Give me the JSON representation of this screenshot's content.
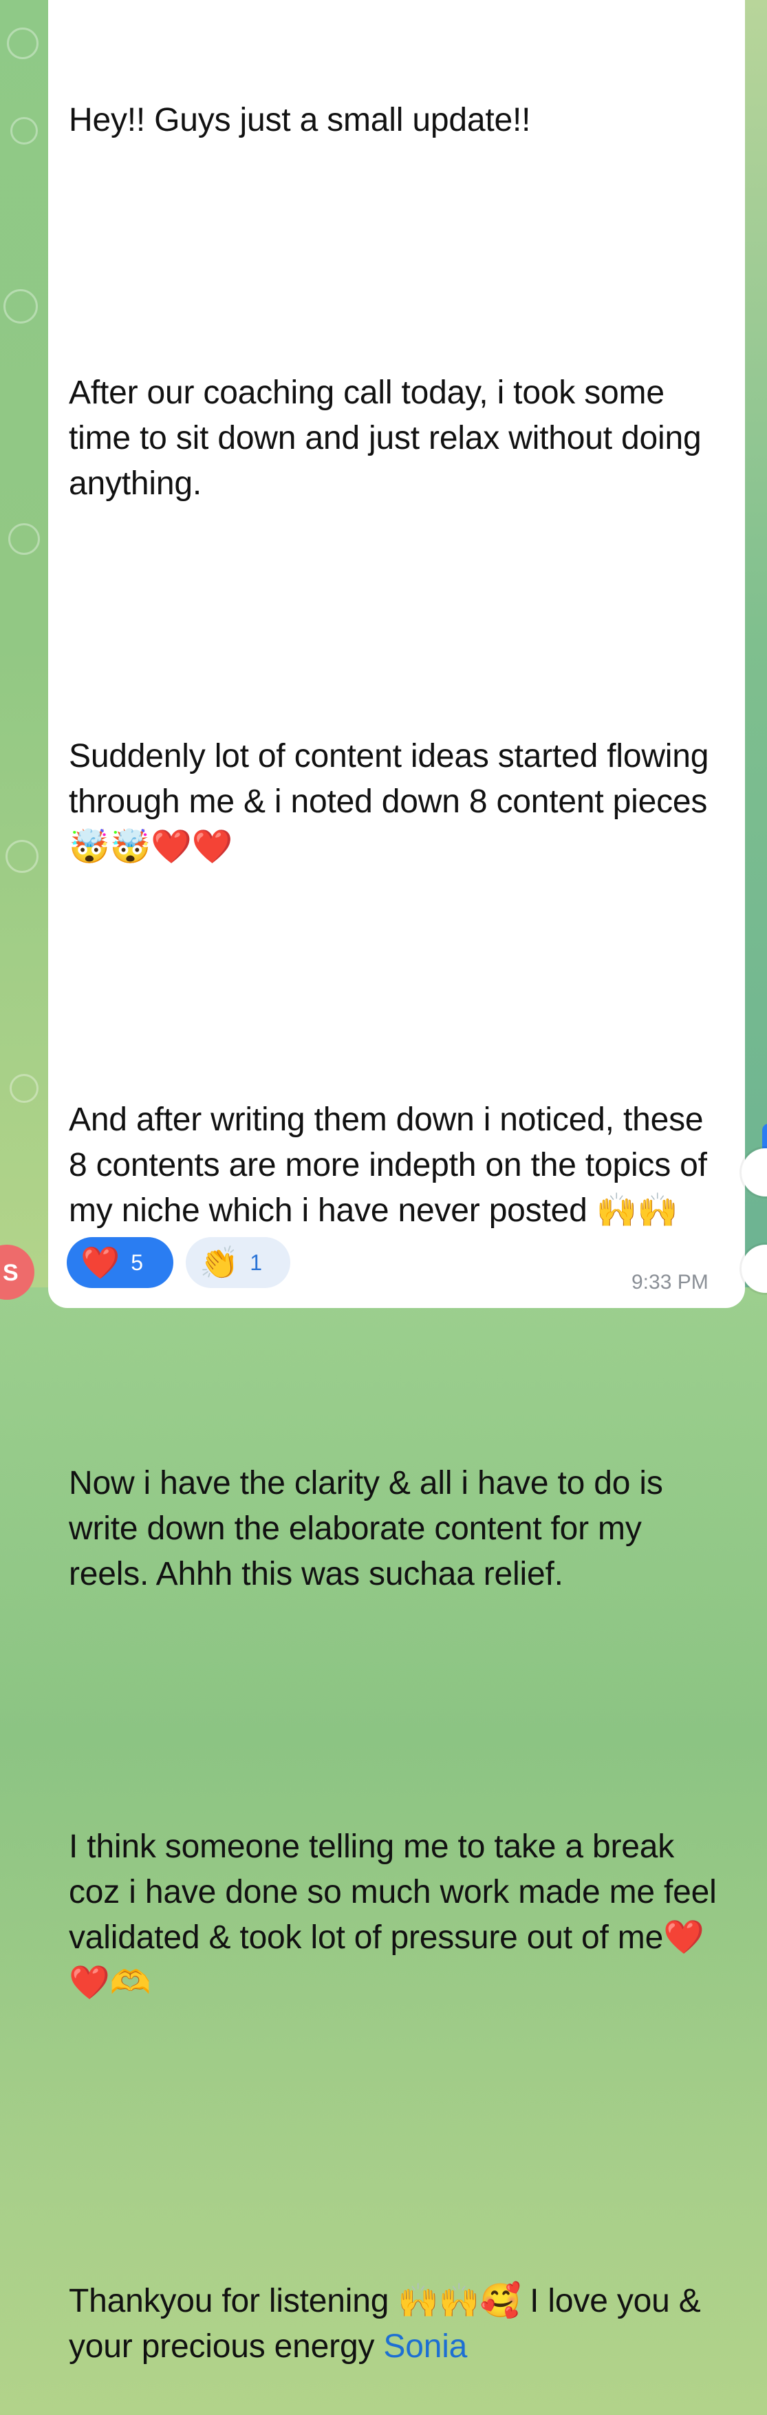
{
  "message": {
    "paragraphs": [
      "Hey!! Guys just a small update!!",
      "After our coaching call today, i took some time to sit down and just relax without doing anything.",
      "Suddenly lot of content ideas started flowing through me & i noted down 8 content pieces 🤯🤯❤️❤️",
      "And after writing them down i noticed, these 8 contents are more indepth on the topics of my niche which i have never posted 🙌🙌",
      "Now i have the clarity & all i have to do is write down the elaborate content for my reels. Ahhh this was suchaa relief.",
      "I think someone telling me to take a break coz i have done so much work made me feel validated & took lot of pressure out of me❤️❤️🫶",
      "Thankyou for listening 🙌🙌🥰 I love you & your precious energy "
    ],
    "mention": "Sonia",
    "timestamp": "9:33 PM"
  },
  "reactions": [
    {
      "emoji": "❤️",
      "count": "5"
    },
    {
      "emoji": "👏",
      "count": "1"
    }
  ],
  "avatar": {
    "initial": "S"
  },
  "colors": {
    "bubble": "#ffffff",
    "mention": "#1d6fd3",
    "reaction_primary": "#2a7df2",
    "reaction_secondary": "#e6eef9",
    "avatar": "#ee6b6b"
  }
}
